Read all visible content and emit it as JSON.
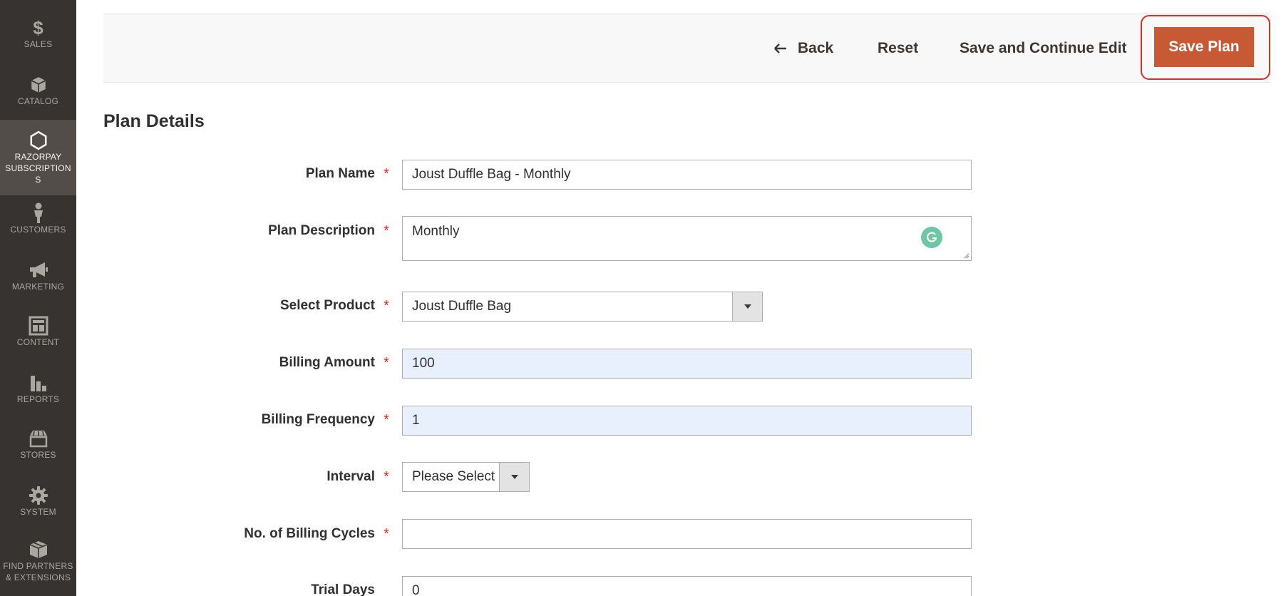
{
  "sidebar": {
    "items": [
      {
        "label": "SALES",
        "icon": "dollar-icon"
      },
      {
        "label": "CATALOG",
        "icon": "cube-icon"
      },
      {
        "label": "RAZORPAY SUBSCRIPTION S",
        "icon": "hexagon-icon"
      },
      {
        "label": "CUSTOMERS",
        "icon": "person-icon"
      },
      {
        "label": "MARKETING",
        "icon": "megaphone-icon"
      },
      {
        "label": "CONTENT",
        "icon": "layout-icon"
      },
      {
        "label": "REPORTS",
        "icon": "bar-chart-icon"
      },
      {
        "label": "STORES",
        "icon": "storefront-icon"
      },
      {
        "label": "SYSTEM",
        "icon": "gear-icon"
      },
      {
        "label": "FIND PARTNERS & EXTENSIONS",
        "icon": "boxes-icon"
      }
    ],
    "active_index": 2
  },
  "toolbar": {
    "back_label": "Back",
    "reset_label": "Reset",
    "save_continue_label": "Save and Continue Edit",
    "save_plan_label": "Save Plan"
  },
  "section": {
    "title": "Plan Details"
  },
  "form": {
    "plan_name": {
      "label": "Plan Name",
      "value": "Joust Duffle Bag - Monthly"
    },
    "plan_description": {
      "label": "Plan Description",
      "value": "Monthly"
    },
    "select_product": {
      "label": "Select Product",
      "value": "Joust Duffle Bag"
    },
    "billing_amount": {
      "label": "Billing Amount",
      "value": "100"
    },
    "billing_frequency": {
      "label": "Billing Frequency",
      "value": "1"
    },
    "interval": {
      "label": "Interval",
      "value": "Please Select"
    },
    "billing_cycles": {
      "label": "No. of Billing Cycles",
      "value": ""
    },
    "trial_days": {
      "label": "Trial Days",
      "value": "0"
    }
  },
  "colors": {
    "sidebar_bg": "#373330",
    "sidebar_active_bg": "#524d49",
    "primary_button": "#c75a35",
    "highlight_outline": "#e02b27",
    "required_star": "#e22626"
  }
}
